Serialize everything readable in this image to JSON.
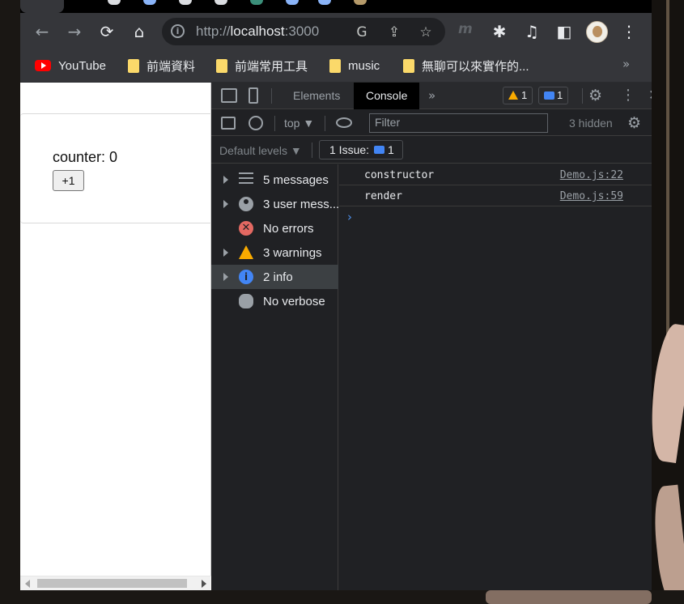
{
  "browser": {
    "url_scheme": "http://",
    "url_host": "localhost",
    "url_port": ":3000",
    "nav": {
      "back_icon": "←",
      "forward_icon": "→",
      "reload_icon": "⟳",
      "home_icon": "⌂"
    },
    "omnibox_icons": {
      "translate": "G",
      "share": "⇪",
      "star": "☆"
    },
    "extensions": {
      "m_label": "m",
      "puzzle": "✱",
      "media": "♫",
      "sidepanel": "◧",
      "menu": "⋮"
    }
  },
  "bookmarks": {
    "items": [
      {
        "label": "YouTube",
        "icon": "youtube-icon"
      },
      {
        "label": "前端資料",
        "icon": "folder-icon"
      },
      {
        "label": "前端常用工具",
        "icon": "folder-icon"
      },
      {
        "label": "music",
        "icon": "folder-icon"
      },
      {
        "label": "無聊可以來實作的...",
        "icon": "folder-icon"
      }
    ],
    "more": "»"
  },
  "page": {
    "counter_text": "counter: 0",
    "button_label": "+1"
  },
  "devtools": {
    "tabs": [
      "Elements",
      "Console"
    ],
    "active_tab": "Console",
    "more_tabs": "»",
    "warnings_count": "1",
    "messages_count": "1",
    "gear": "⚙",
    "kebab": "⋮",
    "close": "✕",
    "context": "top ▼",
    "filter_placeholder": "Filter",
    "hidden_count": "3 hidden",
    "levels_label": "Default levels ▼",
    "issues_label": "1 Issue:",
    "issues_count": "1",
    "sidebar": [
      {
        "label": "5 messages",
        "icon": "list-icon",
        "expandable": true
      },
      {
        "label": "3 user mess...",
        "icon": "user-icon",
        "expandable": true
      },
      {
        "label": "No errors",
        "icon": "error-icon",
        "expandable": false
      },
      {
        "label": "3 warnings",
        "icon": "warning-icon",
        "expandable": true
      },
      {
        "label": "2 info",
        "icon": "info-icon",
        "expandable": true,
        "selected": true
      },
      {
        "label": "No verbose",
        "icon": "bug-icon",
        "expandable": false
      }
    ],
    "logs": [
      {
        "text": "constructor",
        "source": "Demo.js:22"
      },
      {
        "text": "render",
        "source": "Demo.js:59"
      }
    ],
    "prompt": "›"
  }
}
